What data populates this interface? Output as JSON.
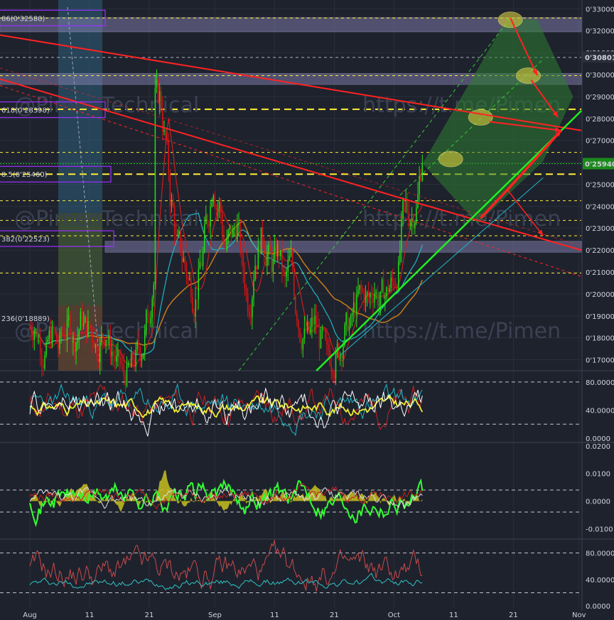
{
  "colors": {
    "background": "#1e222d",
    "grid": "#2a2e39",
    "up": "#22e012",
    "down": "#e01212",
    "fib_yellow": "#ffee33",
    "fib_box_border": "#9b30ff",
    "zone_fill": "#8f8abf",
    "resistance_red": "#ff2222",
    "support_green": "#22ee22",
    "channel_green": "#33cc33",
    "projection_fill": "#2e7d32",
    "target_ellipse": "#c9c13a",
    "ma_orange": "#c77c1a",
    "ma_teal": "#1fb5c4",
    "ma_red": "#c82020",
    "stoch_yellow": "#eeee33",
    "stoch_white": "#ffffff",
    "macd_green": "#33ff33",
    "macd_hist": "#c8c020",
    "rsi_red": "#c84a4a",
    "rsi_teal": "#2fc4c4"
  },
  "watermark": {
    "line1": "@PimenTechnical",
    "line2": "https://t.me/Pimen"
  },
  "price_panel": {
    "ylim": [
      0.165,
      0.334
    ],
    "price_ticks": [
      "0'33000",
      "0'32000",
      "0'31000",
      "0'30000",
      "0'29000",
      "0'28000",
      "0'27000",
      "0'26000",
      "0'25000",
      "0'24000",
      "0'23000",
      "0'22000",
      "0'21000",
      "0'20000",
      "0'19000",
      "0'18000",
      "0'17000"
    ],
    "price_tick_values": [
      0.33,
      0.32,
      0.31,
      0.3,
      0.29,
      0.28,
      0.27,
      0.26,
      0.25,
      0.24,
      0.23,
      0.22,
      0.21,
      0.2,
      0.19,
      0.18,
      0.17
    ],
    "highlight_labels": [
      {
        "text": "0'30801",
        "value": 0.30801,
        "style": "dark"
      },
      {
        "text": "0'25940",
        "value": 0.2594,
        "style": "green"
      }
    ],
    "fib_labels": [
      {
        "text": "86(0'32580)",
        "value": 0.3258
      },
      {
        "text": "618(0'28398)",
        "value": 0.28398
      },
      {
        "text": "0.5(0'25460)",
        "value": 0.2546
      },
      {
        "text": "382(0'22523)",
        "value": 0.22523
      },
      {
        "text": "236(0'18889)",
        "value": 0.18889
      }
    ],
    "zones": [
      {
        "from": 0.3195,
        "to": 0.326
      },
      {
        "from": 0.2955,
        "to": 0.3005
      },
      {
        "from": 0.219,
        "to": 0.224
      }
    ],
    "dashed_levels": [
      0.3258,
      0.3078,
      0.2995,
      0.2842,
      0.2645,
      0.2546,
      0.2425,
      0.2335,
      0.2265,
      0.2095
    ],
    "targets": [
      0.325,
      0.2995,
      0.2805,
      0.2615
    ]
  },
  "stoch_panel": {
    "ylim": [
      -3,
      95
    ],
    "ticks": [
      "80.0000",
      "40.0000",
      "0.0000"
    ],
    "tick_values": [
      80,
      40,
      0
    ],
    "dashed": [
      80,
      20
    ]
  },
  "macd_panel": {
    "ylim": [
      -0.013,
      0.021
    ],
    "ticks": [
      "0.0200",
      "0.0100",
      "0.0000",
      "-0.0100"
    ],
    "tick_values": [
      0.02,
      0.01,
      0.0,
      -0.01
    ],
    "dashed": [
      0.004,
      -0.004
    ]
  },
  "rsi_panel": {
    "ylim": [
      -3,
      100
    ],
    "ticks": [
      "80.0000",
      "40.0000",
      "0.0000"
    ],
    "tick_values": [
      80,
      40,
      0
    ],
    "dashed": [
      80,
      20
    ]
  },
  "time_axis": [
    {
      "label": "Aug",
      "day": 0
    },
    {
      "label": "11",
      "day": 10
    },
    {
      "label": "21",
      "day": 20
    },
    {
      "label": "Sep",
      "day": 31
    },
    {
      "label": "11",
      "day": 41
    },
    {
      "label": "21",
      "day": 51
    },
    {
      "label": "Oct",
      "day": 61
    },
    {
      "label": "11",
      "day": 71
    },
    {
      "label": "21",
      "day": 81
    },
    {
      "label": "Nov",
      "day": 92
    }
  ],
  "chart_data": {
    "type": "candlestick",
    "period": "4h",
    "price_scale": "0'xxxxx",
    "candles_daily_close": [
      0.185,
      0.178,
      0.172,
      0.181,
      0.176,
      0.183,
      0.187,
      0.179,
      0.189,
      0.184,
      0.18,
      0.176,
      0.182,
      0.174,
      0.168,
      0.163,
      0.166,
      0.17,
      0.174,
      0.19,
      0.205,
      0.29,
      0.27,
      0.24,
      0.222,
      0.215,
      0.205,
      0.196,
      0.215,
      0.235,
      0.25,
      0.24,
      0.22,
      0.228,
      0.23,
      0.21,
      0.195,
      0.215,
      0.225,
      0.218,
      0.212,
      0.22,
      0.205,
      0.215,
      0.192,
      0.18,
      0.182,
      0.187,
      0.178,
      0.172,
      0.17,
      0.175,
      0.182,
      0.185,
      0.195,
      0.2,
      0.198,
      0.202,
      0.196,
      0.2,
      0.205,
      0.21,
      0.24,
      0.235,
      0.238,
      0.2594
    ],
    "notes": "Daily closes estimated from the candlestick plot; chart is a 4h crypto pair with Fibonacci retracement levels, resistance/support trendlines and projected targets."
  }
}
